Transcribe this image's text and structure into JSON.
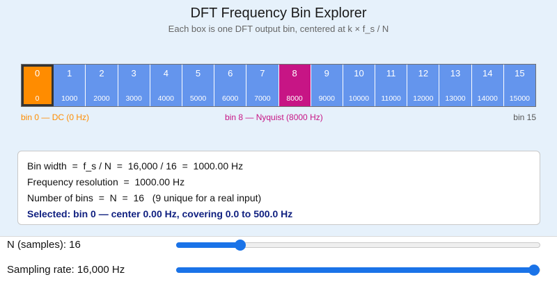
{
  "title": "DFT Frequency Bin Explorer",
  "subtitle": "Each box is one DFT output bin, centered at k × f_s / N",
  "bins": [
    {
      "k": "0",
      "freq": "0",
      "kind": "dc"
    },
    {
      "k": "1",
      "freq": "1000",
      "kind": "normal"
    },
    {
      "k": "2",
      "freq": "2000",
      "kind": "normal"
    },
    {
      "k": "3",
      "freq": "3000",
      "kind": "normal"
    },
    {
      "k": "4",
      "freq": "4000",
      "kind": "normal"
    },
    {
      "k": "5",
      "freq": "5000",
      "kind": "normal"
    },
    {
      "k": "6",
      "freq": "6000",
      "kind": "normal"
    },
    {
      "k": "7",
      "freq": "7000",
      "kind": "normal"
    },
    {
      "k": "8",
      "freq": "8000",
      "kind": "nyquist"
    },
    {
      "k": "9",
      "freq": "9000",
      "kind": "normal"
    },
    {
      "k": "10",
      "freq": "10000",
      "kind": "normal"
    },
    {
      "k": "11",
      "freq": "11000",
      "kind": "normal"
    },
    {
      "k": "12",
      "freq": "12000",
      "kind": "normal"
    },
    {
      "k": "13",
      "freq": "13000",
      "kind": "normal"
    },
    {
      "k": "14",
      "freq": "14000",
      "kind": "normal"
    },
    {
      "k": "15",
      "freq": "15000",
      "kind": "normal"
    }
  ],
  "labels": {
    "dc": "bin 0 — DC (0 Hz)",
    "nyquist": "bin 8 — Nyquist (8000 Hz)",
    "last": "bin 15"
  },
  "info": {
    "bin_width": "Bin width  =  f_s / N  =  16,000 / 16  =  1000.00 Hz",
    "resolution": "Frequency resolution  =  1000.00 Hz",
    "num_bins": "Number of bins  =  N  =  16   (9 unique for a real input)",
    "selected": "Selected: bin 0 — center 0.00 Hz, covering 0.0 to 500.0 Hz"
  },
  "controls": {
    "n_label": "N (samples): 16",
    "n_fraction": 0.175,
    "fs_label": "Sampling rate: 16,000 Hz",
    "fs_fraction": 1.0
  },
  "colors": {
    "bin": "#6495ed",
    "dc": "#ff8c00",
    "nyquist": "#c71585",
    "slider": "#1a73e8"
  }
}
